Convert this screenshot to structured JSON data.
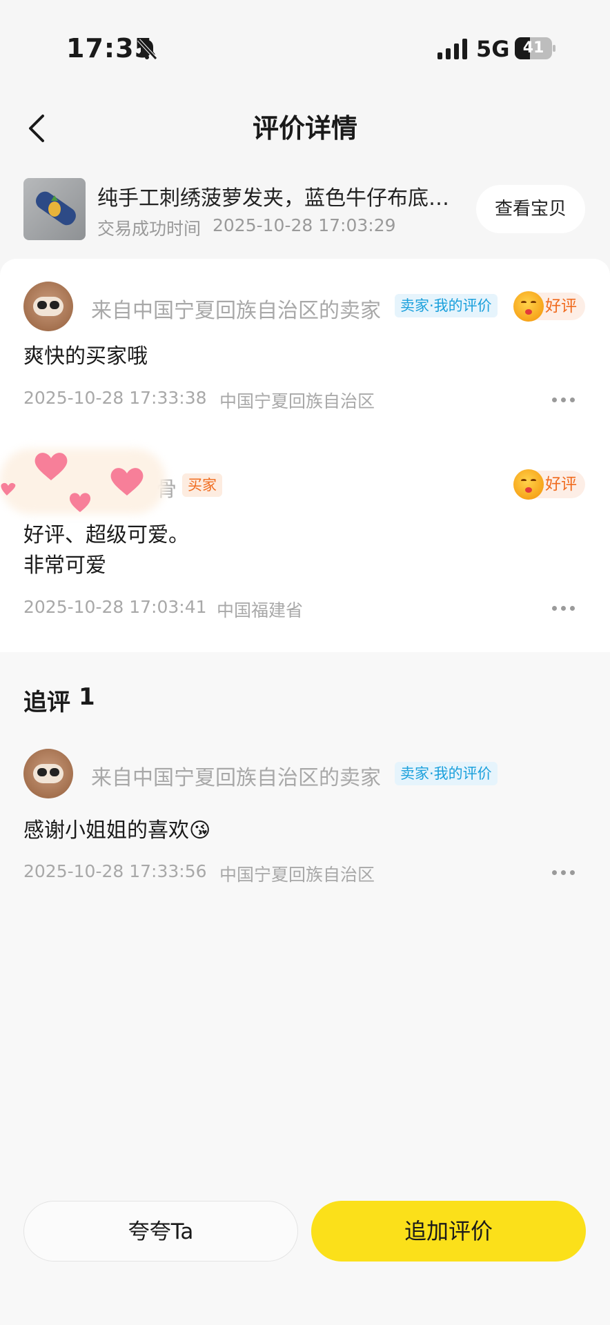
{
  "status_bar": {
    "time": "17:35",
    "network": "5G",
    "battery": "41",
    "battery_level": 0.41
  },
  "header": {
    "title": "评价详情"
  },
  "product": {
    "name": "纯手工刺绣菠萝发夹，蓝色牛仔布底…",
    "time_label": "交易成功时间",
    "time_value": "2025-10-28 17:03:29",
    "view_button": "查看宝贝"
  },
  "reviews": [
    {
      "reviewer": "来自中国宁夏回族自治区的卖家",
      "tag": "卖家·我的评价",
      "rating": "好评",
      "lines": [
        "爽快的买家哦"
      ],
      "time": "2025-10-28 17:33:38",
      "location": "中国宁夏回族自治区"
    },
    {
      "reviewer_partial": "骨",
      "tag": "买家",
      "rating": "好评",
      "lines": [
        "好评、超级可爱。",
        "非常可爱"
      ],
      "time": "2025-10-28 17:03:41",
      "location": "中国福建省"
    }
  ],
  "followup": {
    "title": "追评",
    "count": "1",
    "item": {
      "reviewer": "来自中国宁夏回族自治区的卖家",
      "tag": "卖家·我的评价",
      "text": "感谢小姐姐的喜欢😘",
      "time": "2025-10-28 17:33:56",
      "location": "中国宁夏回族自治区"
    }
  },
  "buttons": {
    "praise": "夸夸Ta",
    "add_review": "追加评价"
  },
  "colors": {
    "accent_yellow": "#fbe01a",
    "tag_blue": "#1ba0dc",
    "tag_orange": "#f06b1e"
  },
  "icons": {
    "back": "back-chevron-icon",
    "bell": "bell-slash-icon",
    "more": "more-dots-icon"
  }
}
